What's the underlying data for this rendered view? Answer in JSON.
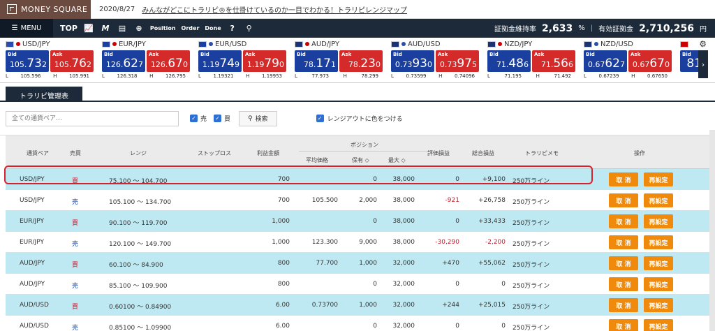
{
  "brand": {
    "name": "MONEY SQUARE"
  },
  "news": {
    "date": "2020/8/27",
    "headline": "みんながどこにトラリピ®を仕掛けているのか一目でわかる！トラリピレンジマップ"
  },
  "nav": {
    "menu_label": "MENU",
    "icons": [
      "TOP",
      "chart-icon",
      "mw-icon",
      "document-icon",
      "plus-icon",
      "Position",
      "Order",
      "Done",
      "help-icon",
      "user-icon"
    ],
    "top_label": "TOP",
    "position_label": "Position",
    "order_label": "Order",
    "done_label": "Done",
    "margin_rate_label": "証拠金維持率",
    "margin_rate_value": "2,633",
    "margin_rate_unit": "%",
    "valid_margin_label": "有効証拠金",
    "valid_margin_value": "2,710,256",
    "valid_margin_unit": "円"
  },
  "ticker": [
    {
      "pair": "USD/JPY",
      "bid_main": "105.",
      "bid_big": "73",
      "bid_tail": "2",
      "ask_main": "105.",
      "ask_big": "76",
      "ask_tail": "2",
      "low": "105.596",
      "high": "105.991"
    },
    {
      "pair": "EUR/JPY",
      "bid_main": "126.",
      "bid_big": "62",
      "bid_tail": "7",
      "ask_main": "126.",
      "ask_big": "67",
      "ask_tail": "0",
      "low": "126.318",
      "high": "126.795"
    },
    {
      "pair": "EUR/USD",
      "bid_main": "1.19",
      "bid_big": "74",
      "bid_tail": "9",
      "ask_main": "1.19",
      "ask_big": "79",
      "ask_tail": "0",
      "low": "1.19321",
      "high": "1.19953"
    },
    {
      "pair": "AUD/JPY",
      "bid_main": "78.",
      "bid_big": "17",
      "bid_tail": "1",
      "ask_main": "78.",
      "ask_big": "23",
      "ask_tail": "0",
      "low": "77.973",
      "high": "78.299"
    },
    {
      "pair": "AUD/USD",
      "bid_main": "0.73",
      "bid_big": "93",
      "bid_tail": "0",
      "ask_main": "0.73",
      "ask_big": "97",
      "ask_tail": "5",
      "low": "0.73599",
      "high": "0.74096"
    },
    {
      "pair": "NZD/JPY",
      "bid_main": "71.",
      "bid_big": "48",
      "bid_tail": "6",
      "ask_main": "71.",
      "ask_big": "56",
      "ask_tail": "6",
      "low": "71.195",
      "high": "71.492"
    },
    {
      "pair": "NZD/USD",
      "bid_main": "0.67",
      "bid_big": "62",
      "bid_tail": "7",
      "ask_main": "0.67",
      "ask_big": "67",
      "ask_tail": "0",
      "low": "0.67239",
      "high": "0.67650"
    }
  ],
  "ticker_labels": {
    "bid": "Bid",
    "ask": "Ask",
    "low": "L",
    "high": "H",
    "partial_bid": "81"
  },
  "tab": {
    "label": "トラリピ管理表"
  },
  "filters": {
    "search_placeholder": "全ての通貨ペア…",
    "sell_label": "売",
    "buy_label": "買",
    "search_button": "検索",
    "range_color_label": "レンジアウトに色をつける"
  },
  "table": {
    "headers": {
      "pair": "通貨ペア",
      "side": "売買",
      "range": "レンジ",
      "stop": "ストップロス",
      "profit": "利益金額",
      "position": "ポジション",
      "avg": "平均価格",
      "held": "保有 ◇",
      "max": "最大 ◇",
      "eval": "評価損益",
      "total": "総合損益",
      "memo": "トラリピメモ",
      "ops": "操作"
    },
    "cancel_label": "取 消",
    "reset_label": "再設定",
    "rows": [
      {
        "pair": "USD/JPY",
        "side": "買",
        "range": "75.100 〜 104.700",
        "profit": "700",
        "avg": "",
        "held": "0",
        "max": "38,000",
        "eval": "0",
        "total": "+9,100",
        "memo": "250万ライン"
      },
      {
        "pair": "USD/JPY",
        "side": "売",
        "range": "105.100 〜 134.700",
        "profit": "700",
        "avg": "105.500",
        "held": "2,000",
        "max": "38,000",
        "eval": "-921",
        "total": "+26,758",
        "memo": "250万ライン"
      },
      {
        "pair": "EUR/JPY",
        "side": "買",
        "range": "90.100 〜 119.700",
        "profit": "1,000",
        "avg": "",
        "held": "0",
        "max": "38,000",
        "eval": "0",
        "total": "+33,433",
        "memo": "250万ライン"
      },
      {
        "pair": "EUR/JPY",
        "side": "売",
        "range": "120.100 〜 149.700",
        "profit": "1,000",
        "avg": "123.300",
        "held": "9,000",
        "max": "38,000",
        "eval": "-30,290",
        "total": "-2,200",
        "memo": "250万ライン"
      },
      {
        "pair": "AUD/JPY",
        "side": "買",
        "range": "60.100 〜 84.900",
        "profit": "800",
        "avg": "77.700",
        "held": "1,000",
        "max": "32,000",
        "eval": "+470",
        "total": "+55,062",
        "memo": "250万ライン"
      },
      {
        "pair": "AUD/JPY",
        "side": "売",
        "range": "85.100 〜 109.900",
        "profit": "800",
        "avg": "",
        "held": "0",
        "max": "32,000",
        "eval": "0",
        "total": "0",
        "memo": "250万ライン"
      },
      {
        "pair": "AUD/USD",
        "side": "買",
        "range": "0.60100 〜 0.84900",
        "profit": "6.00",
        "avg": "0.73700",
        "held": "1,000",
        "max": "32,000",
        "eval": "+244",
        "total": "+25,015",
        "memo": "250万ライン"
      },
      {
        "pair": "AUD/USD",
        "side": "売",
        "range": "0.85100 〜 1.09900",
        "profit": "6.00",
        "avg": "",
        "held": "0",
        "max": "32,000",
        "eval": "0",
        "total": "0",
        "memo": "250万ライン"
      }
    ]
  }
}
